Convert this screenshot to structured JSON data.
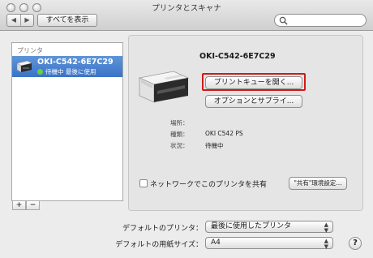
{
  "window": {
    "title": "プリンタとスキャナ",
    "show_all": "すべてを表示",
    "search_placeholder": ""
  },
  "sidebar": {
    "header": "プリンタ",
    "items": [
      {
        "name": "OKI-C542-6E7C29",
        "status": "待機中 最後に使用"
      }
    ],
    "add_label": "+",
    "remove_label": "−"
  },
  "detail": {
    "printer_name": "OKI-C542-6E7C29",
    "open_queue_button": "プリントキューを開く...",
    "options_button": "オプションとサプライ...",
    "fields": [
      {
        "label": "場所：",
        "value": ""
      },
      {
        "label": "種類：",
        "value": "OKI C542 PS"
      },
      {
        "label": "状況：",
        "value": "待機中"
      }
    ],
    "share_checkbox_label": "ネットワークでこのプリンタを共有",
    "share_settings_button": "\"共有\"環境設定...",
    "share_checked": false
  },
  "bottom": {
    "default_printer_label": "デフォルトのプリンタ：",
    "default_printer_value": "最後に使用したプリンタ",
    "default_paper_label": "デフォルトの用紙サイズ：",
    "default_paper_value": "A4"
  },
  "colors": {
    "selection": "#3a73c8",
    "status_dot": "#6cce3f",
    "highlight_box": "#d21919"
  }
}
